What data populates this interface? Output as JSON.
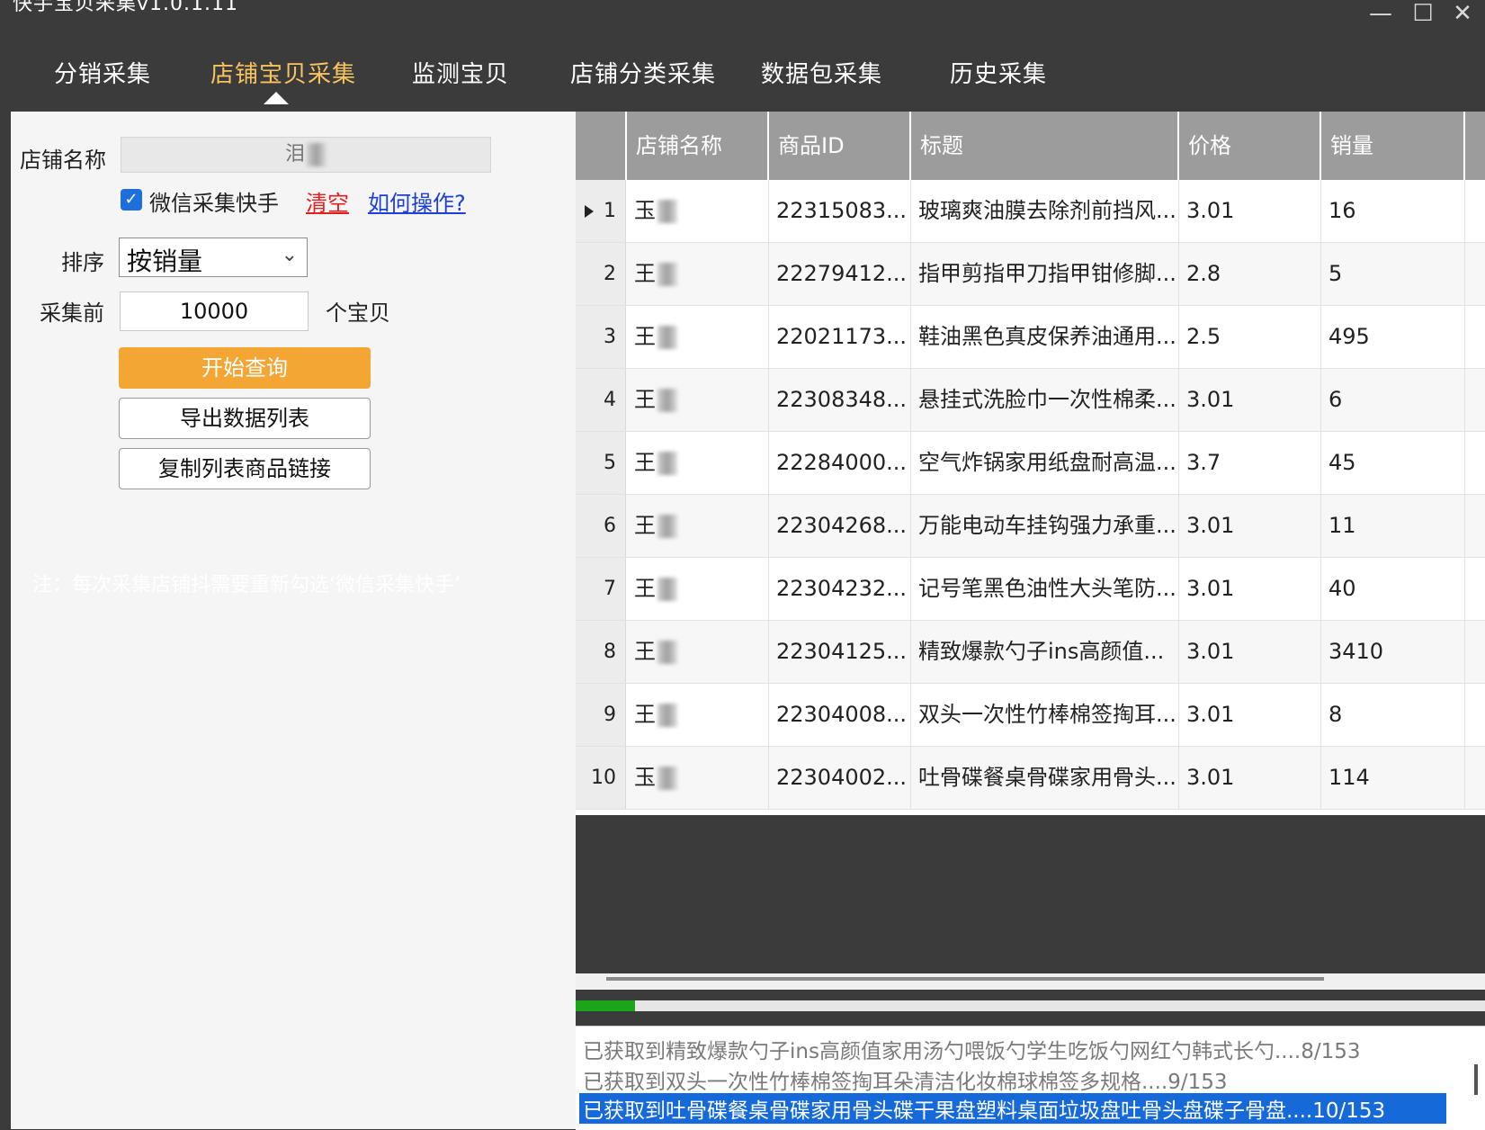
{
  "window": {
    "title": "快手宝贝采集v1.0.1.11",
    "minimize_icon": "minimize-icon",
    "maximize_icon": "maximize-icon",
    "close_icon": "close-icon"
  },
  "nav": {
    "tabs": [
      "分销采集",
      "店铺宝贝采集",
      "监测宝贝",
      "店铺分类采集",
      "数据包采集",
      "历史采集"
    ],
    "active_index": 1,
    "active_color": "#f8c45c"
  },
  "form": {
    "shop_label": "店铺名称",
    "shop_value": "泪",
    "wechat_checkbox_label": "微信采集快手",
    "wechat_checked": true,
    "clear_link": "清空",
    "help_link": "如何操作?",
    "sort_label": "排序",
    "sort_value": "按销量",
    "limit_label": "采集前",
    "limit_value": "10000",
    "limit_unit": "个宝贝",
    "start_button": "开始查询",
    "export_button": "导出数据列表",
    "copy_button": "复制列表商品链接",
    "note": "注：每次采集店铺抖需要重新勾选‘微信采集快手’"
  },
  "table": {
    "headers": [
      "店铺名称",
      "商品ID",
      "标题",
      "价格",
      "销量"
    ],
    "rows": [
      {
        "num": "1",
        "shop": "玉",
        "id": "22315083...",
        "title": "玻璃爽油膜去除剂前挡风...",
        "price": "3.01",
        "sales": "16"
      },
      {
        "num": "2",
        "shop": "王",
        "id": "22279412...",
        "title": "指甲剪指甲刀指甲钳修脚...",
        "price": "2.8",
        "sales": "5"
      },
      {
        "num": "3",
        "shop": "王",
        "id": "22021173...",
        "title": "鞋油黑色真皮保养油通用...",
        "price": "2.5",
        "sales": "495"
      },
      {
        "num": "4",
        "shop": "王",
        "id": "22308348...",
        "title": "悬挂式洗脸巾一次性棉柔...",
        "price": "3.01",
        "sales": "6"
      },
      {
        "num": "5",
        "shop": "王",
        "id": "22284000...",
        "title": "空气炸锅家用纸盘耐高温...",
        "price": "3.7",
        "sales": "45"
      },
      {
        "num": "6",
        "shop": "王",
        "id": "22304268...",
        "title": "万能电动车挂钩强力承重...",
        "price": "3.01",
        "sales": "11"
      },
      {
        "num": "7",
        "shop": "王",
        "id": "22304232...",
        "title": "记号笔黑色油性大头笔防...",
        "price": "3.01",
        "sales": "40"
      },
      {
        "num": "8",
        "shop": "王",
        "id": "22304125...",
        "title": "精致爆款勺子ins高颜值...",
        "price": "3.01",
        "sales": "3410"
      },
      {
        "num": "9",
        "shop": "王",
        "id": "22304008...",
        "title": "双头一次性竹棒棉签掏耳...",
        "price": "3.01",
        "sales": "8"
      },
      {
        "num": "10",
        "shop": "玉",
        "id": "22304002...",
        "title": "吐骨碟餐桌骨碟家用骨头...",
        "price": "3.01",
        "sales": "114"
      }
    ]
  },
  "progress": {
    "fraction": 0.065,
    "color": "#1aa51a"
  },
  "log": {
    "lines": [
      "已获取到精致爆款勺子ins高颜值家用汤勺喂饭勺学生吃饭勺网红勺韩式长勺....8/153",
      "已获取到双头一次性竹棒棉签掏耳朵清洁化妆棉球棉签多规格....9/153",
      "已获取到吐骨碟餐桌骨碟家用骨头碟干果盘塑料桌面垃圾盘吐骨头盘碟子骨盘....10/153"
    ],
    "selected_index": 2
  }
}
